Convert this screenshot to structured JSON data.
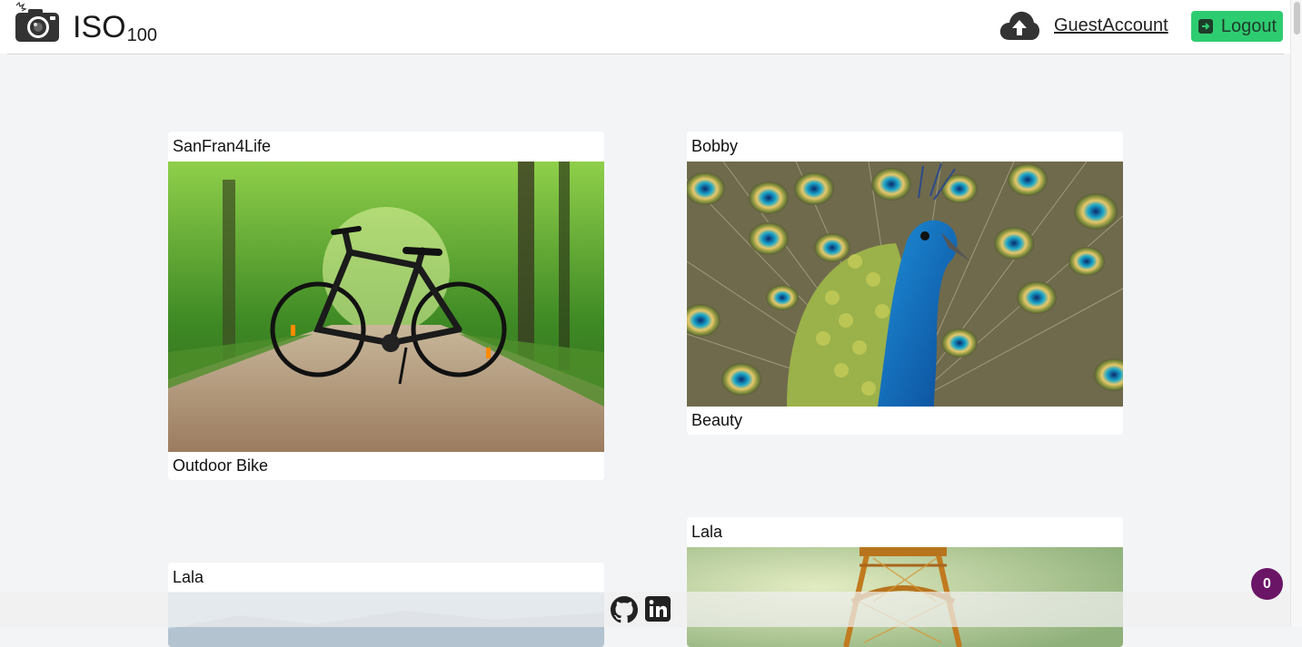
{
  "header": {
    "brand": "ISO",
    "brand_sub": "100",
    "account_link": "GuestAccount",
    "logout_label": "Logout"
  },
  "icons": {
    "logo": "camera-icon",
    "upload": "cloud-upload-icon",
    "logout": "sign-out-icon",
    "github": "github-icon",
    "linkedin": "linkedin-icon"
  },
  "posts": [
    {
      "user": "SanFran4Life",
      "caption": "Outdoor Bike",
      "photo": "bicycle on forest path"
    },
    {
      "user": "Bobby",
      "caption": "Beauty",
      "photo": "peacock with fanned feathers"
    },
    {
      "user": "Lala",
      "caption": "",
      "photo": "sky over hills"
    },
    {
      "user": "Lala",
      "caption": "",
      "photo": "eiffel tower"
    }
  ],
  "notification_count": "0",
  "colors": {
    "accent": "#2ecc71",
    "badge": "#6b1567",
    "background": "#f3f4f6"
  }
}
